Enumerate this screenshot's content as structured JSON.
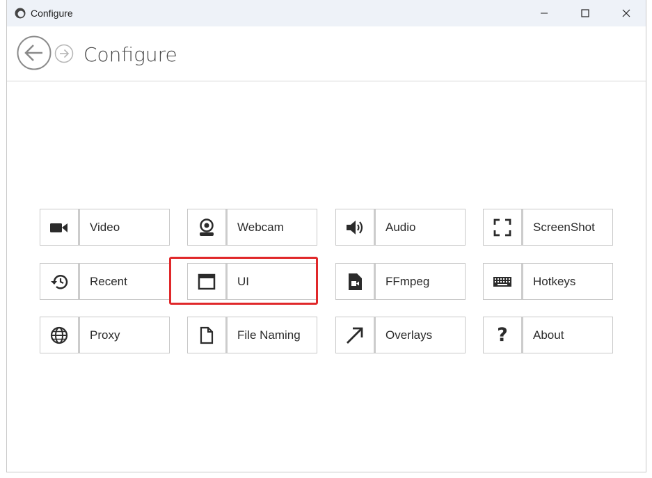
{
  "window": {
    "title": "Configure"
  },
  "header": {
    "title": "Configure"
  },
  "tiles": [
    {
      "label": "Video",
      "icon": "video-camera-icon"
    },
    {
      "label": "Webcam",
      "icon": "webcam-icon"
    },
    {
      "label": "Audio",
      "icon": "speaker-icon"
    },
    {
      "label": "ScreenShot",
      "icon": "screenshot-frame-icon"
    },
    {
      "label": "Recent",
      "icon": "history-icon"
    },
    {
      "label": "UI",
      "icon": "window-icon"
    },
    {
      "label": "FFmpeg",
      "icon": "video-file-icon"
    },
    {
      "label": "Hotkeys",
      "icon": "keyboard-icon"
    },
    {
      "label": "Proxy",
      "icon": "globe-icon"
    },
    {
      "label": "File Naming",
      "icon": "file-icon"
    },
    {
      "label": "Overlays",
      "icon": "arrow-up-right-icon"
    },
    {
      "label": "About",
      "icon": "question-mark-icon"
    }
  ],
  "highlighted_tile": "UI",
  "colors": {
    "highlight": "#e0282a",
    "titlebar": "#eef2f8",
    "icon": "#2b2b2b"
  }
}
